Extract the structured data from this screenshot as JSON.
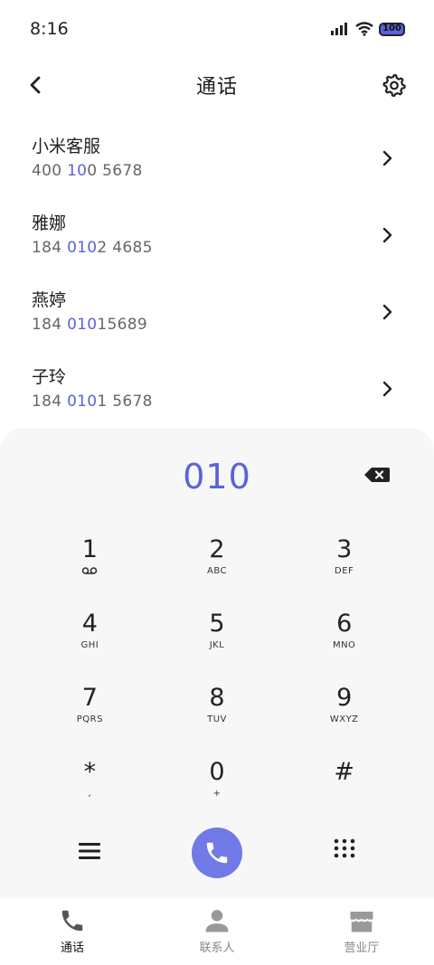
{
  "status_bar": {
    "time": "8:16",
    "battery": "100",
    "icons": [
      "signal-icon",
      "wifi-icon",
      "battery-icon"
    ]
  },
  "header": {
    "title": "通话"
  },
  "contacts": [
    {
      "name": "小米客服",
      "number_parts": [
        "400 ",
        "10",
        "0 5678"
      ]
    },
    {
      "name": "雅娜",
      "number_parts": [
        "184 ",
        "010",
        "2 4685"
      ]
    },
    {
      "name": "燕婷",
      "number_parts": [
        "184 ",
        "010",
        "15689"
      ]
    },
    {
      "name": "子玲",
      "number_parts": [
        "184 ",
        "010",
        "1 5678"
      ]
    }
  ],
  "dialer": {
    "input": "010",
    "keys": [
      [
        {
          "digit": "1",
          "sub": ""
        },
        {
          "digit": "2",
          "sub": "ABC"
        },
        {
          "digit": "3",
          "sub": "DEF"
        }
      ],
      [
        {
          "digit": "4",
          "sub": "GHI"
        },
        {
          "digit": "5",
          "sub": "JKL"
        },
        {
          "digit": "6",
          "sub": "MNO"
        }
      ],
      [
        {
          "digit": "7",
          "sub": "PQRS"
        },
        {
          "digit": "8",
          "sub": "TUV"
        },
        {
          "digit": "9",
          "sub": "WXYZ"
        }
      ],
      [
        {
          "digit": "*",
          "sub": ","
        },
        {
          "digit": "0",
          "sub": "+"
        },
        {
          "digit": "#",
          "sub": ""
        }
      ]
    ]
  },
  "tabs": [
    {
      "label": "通话",
      "icon": "phone-icon",
      "active": true
    },
    {
      "label": "联系人",
      "icon": "person-icon",
      "active": false
    },
    {
      "label": "营业厅",
      "icon": "store-icon",
      "active": false
    }
  ],
  "colors": {
    "accent": "#5b63d9",
    "call_button": "#7179e6",
    "panel_bg": "#f7f7f7"
  }
}
